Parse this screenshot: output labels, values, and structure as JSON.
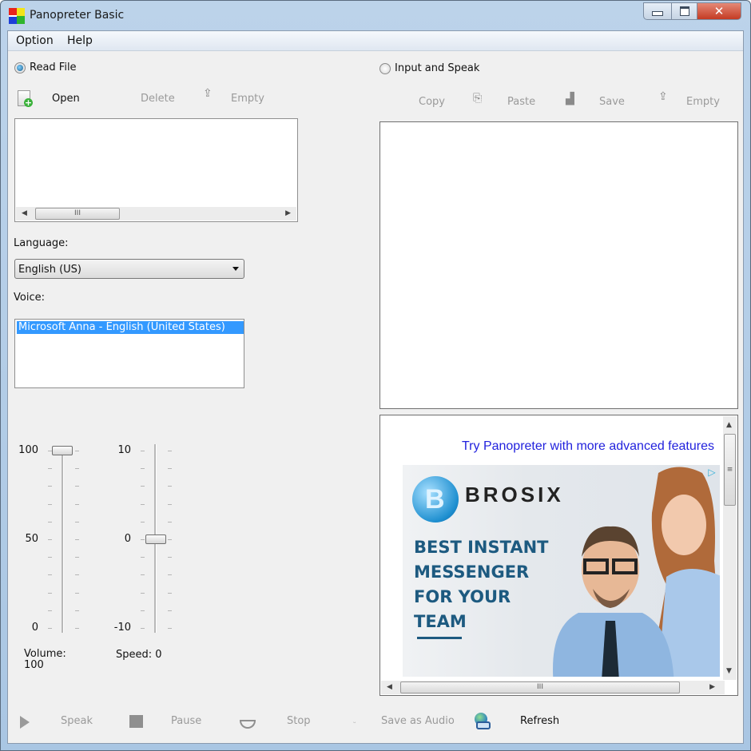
{
  "window": {
    "title": "Panopreter Basic",
    "controls": {
      "minimize": "minimize",
      "maximize": "maximize",
      "close": "✕"
    }
  },
  "menu": {
    "items": [
      "Option",
      "Help"
    ]
  },
  "left": {
    "mode_label": "Read File",
    "mode_selected": true,
    "toolbar": {
      "open": "Open",
      "delete": "Delete",
      "empty": "Empty"
    },
    "file_list": {
      "items": [],
      "scroll_thumb_glyph": "III"
    },
    "language_label": "Language:",
    "language_value": "English (US)",
    "voice_label": "Voice:",
    "voices": [
      "Microsoft Anna - English (United States)"
    ],
    "volume": {
      "max_label": "100",
      "mid_label": "50",
      "min_label": "0",
      "value": 100,
      "min": 0,
      "max": 100,
      "caption": "Volume: 100"
    },
    "speed": {
      "max_label": "10",
      "mid_label": "0",
      "min_label": "-10",
      "value": 0,
      "min": -10,
      "max": 10,
      "caption": "Speed: 0"
    }
  },
  "right": {
    "mode_label": "Input and Speak",
    "mode_selected": false,
    "toolbar": {
      "copy": "Copy",
      "paste": "Paste",
      "save": "Save",
      "empty": "Empty"
    },
    "text_area": "",
    "ad": {
      "link_text": "Try Panopreter with more advanced features",
      "brand": "BROSIX",
      "logo_letter": "B",
      "headline": [
        "BEST INSTANT",
        "MESSENGER",
        "FOR YOUR",
        "TEAM"
      ],
      "badge": "▷",
      "scroll_thumb_glyph": "III",
      "vscroll_thumb_glyph": "≡"
    }
  },
  "bottom": {
    "speak": "Speak",
    "pause": "Pause",
    "stop": "Stop",
    "save_audio": "Save as Audio",
    "refresh": "Refresh"
  },
  "colors": {
    "ad_link": "#2222dd",
    "selection": "#3399ff",
    "ad_headline": "#1d5a80",
    "close_button": "#c43b24"
  }
}
